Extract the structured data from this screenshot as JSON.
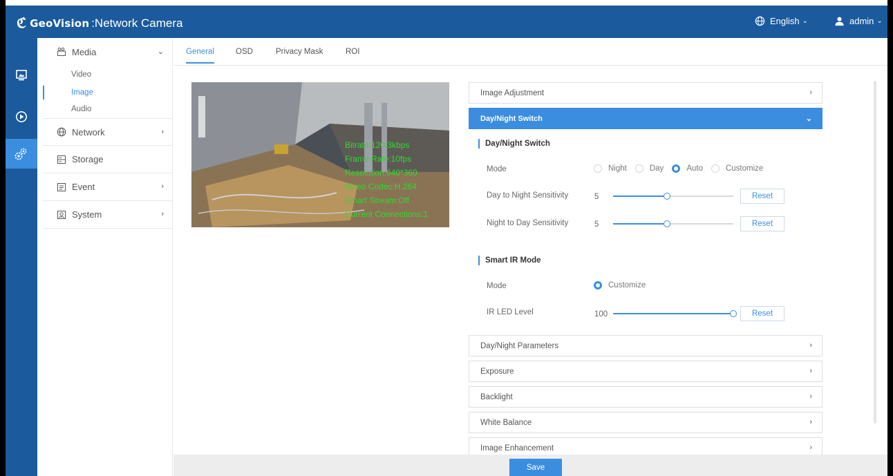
{
  "header": {
    "brand_word": "GeoVision",
    "product": ":Network Camera",
    "language": "English",
    "user": "admin"
  },
  "iconbar": {
    "items": [
      {
        "icon": "monitor-icon"
      },
      {
        "icon": "playback-icon"
      },
      {
        "icon": "settings-gears-icon",
        "active": true
      }
    ]
  },
  "sidebar": {
    "media": {
      "label": "Media",
      "items": [
        {
          "label": "Video"
        },
        {
          "label": "Image",
          "active": true
        },
        {
          "label": "Audio"
        }
      ]
    },
    "network": {
      "label": "Network"
    },
    "storage": {
      "label": "Storage"
    },
    "event": {
      "label": "Event"
    },
    "system": {
      "label": "System"
    }
  },
  "tabs": [
    {
      "label": "General",
      "active": true
    },
    {
      "label": "OSD"
    },
    {
      "label": "Privacy Mask"
    },
    {
      "label": "ROI"
    }
  ],
  "preview": {
    "osd_lines": [
      "Bitrate:120.3kbps",
      "Frame Rate:10fps",
      "Resolution:640*360",
      "Video Codec:H.264",
      "Smart Stream:Off",
      "Current Connections:1"
    ]
  },
  "panel": {
    "image_adjustment": "Image Adjustment",
    "day_night_switch": "Day/Night Switch",
    "dn_section_title": "Day/Night Switch",
    "mode_label": "Mode",
    "mode_options": [
      {
        "label": "Night",
        "selected": false
      },
      {
        "label": "Day",
        "selected": false
      },
      {
        "label": "Auto",
        "selected": true
      },
      {
        "label": "Customize",
        "selected": false
      }
    ],
    "d2n_label": "Day to Night Sensitivity",
    "d2n_value": "5",
    "d2n_fraction": 0.45,
    "n2d_label": "Night to Day Sensitivity",
    "n2d_value": "5",
    "n2d_fraction": 0.45,
    "reset_label": "Reset",
    "ir_section_title": "Smart IR Mode",
    "ir_mode_label": "Mode",
    "ir_mode_option": "Customize",
    "ir_led_label": "IR LED Level",
    "ir_led_value": "100",
    "ir_led_fraction": 1.0,
    "day_night_parameters": "Day/Night Parameters",
    "exposure": "Exposure",
    "backlight": "Backlight",
    "white_balance": "White Balance",
    "image_enhancement": "Image Enhancement"
  },
  "footer": {
    "save_label": "Save"
  },
  "colors": {
    "header_bg": "#1b5a9d",
    "accent": "#3b8de0",
    "osd_text": "#2ddc2d"
  }
}
